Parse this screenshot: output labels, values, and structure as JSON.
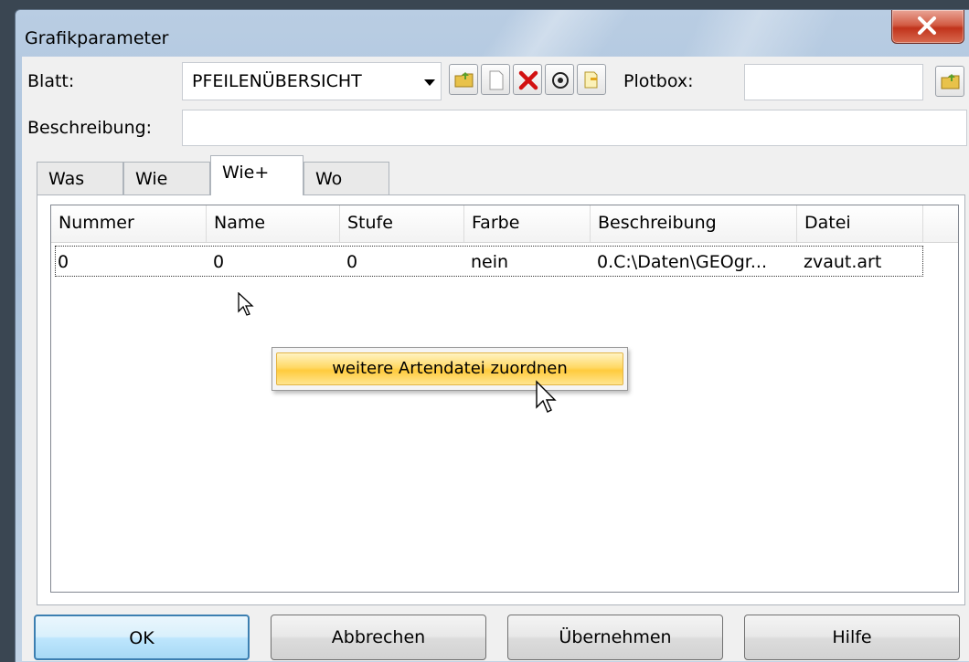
{
  "window": {
    "title": "Grafikparameter"
  },
  "form": {
    "blatt_label": "Blatt:",
    "blatt_value": "PFEILENÜBERSICHT",
    "plotbox_label": "Plotbox:",
    "plotbox_value": "",
    "beschreibung_label": "Beschreibung:",
    "beschreibung_value": ""
  },
  "toolbar": {
    "icons": [
      "open-folder-icon",
      "new-page-icon",
      "delete-icon",
      "add-circle-icon",
      "copy-icon"
    ]
  },
  "tabs": [
    {
      "label": "Was",
      "active": false
    },
    {
      "label": "Wie",
      "active": false
    },
    {
      "label": "Wie+",
      "active": true
    },
    {
      "label": "Wo",
      "active": false
    }
  ],
  "table": {
    "columns": [
      "Nummer",
      "Name",
      "Stufe",
      "Farbe",
      "Beschreibung",
      "Datei"
    ],
    "rows": [
      [
        "0",
        "0",
        "0",
        "nein",
        "0.C:\\Daten\\GEOgr...",
        "zvaut.art"
      ]
    ]
  },
  "context_menu": {
    "items": [
      "weitere Artendatei zuordnen"
    ]
  },
  "buttons": {
    "ok": "OK",
    "cancel": "Abbrechen",
    "apply": "Übernehmen",
    "help": "Hilfe"
  },
  "colors": {
    "close_button": "#c1331b",
    "menu_highlight": "#ffd966",
    "default_button_border": "#3c7fb1"
  }
}
